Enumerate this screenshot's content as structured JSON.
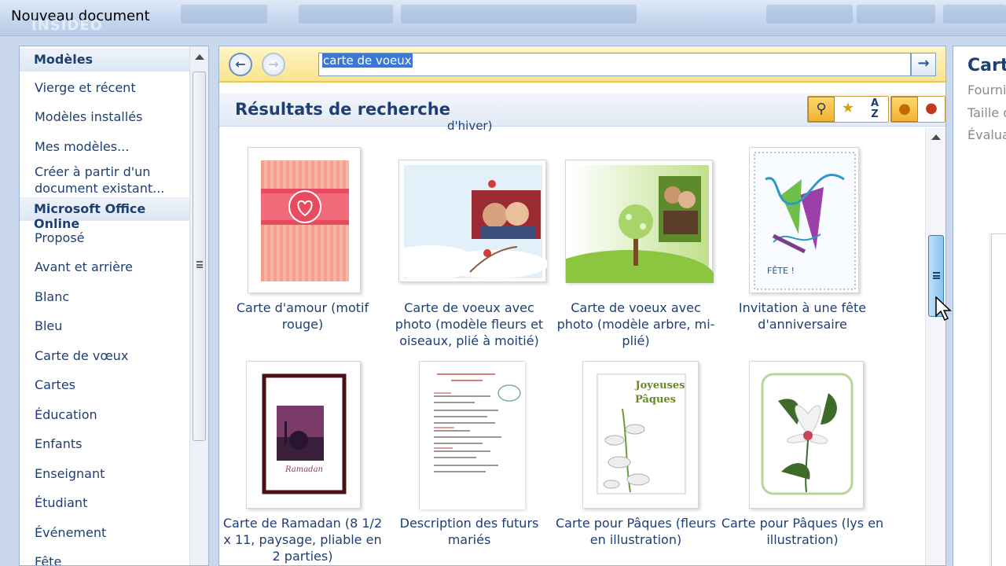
{
  "window": {
    "title": "Nouveau document",
    "watermark": "INSIDEO"
  },
  "sidebar": {
    "sections": [
      {
        "label": "Modèles"
      },
      {
        "label": "Microsoft Office Online"
      }
    ],
    "items_top": [
      {
        "label": "Vierge et récent"
      },
      {
        "label": "Modèles installés"
      },
      {
        "label": "Mes modèles..."
      },
      {
        "label": "Créer à partir d'un document existant..."
      }
    ],
    "items_online": [
      {
        "label": "Proposé"
      },
      {
        "label": "Avant et arrière"
      },
      {
        "label": "Blanc"
      },
      {
        "label": "Bleu"
      },
      {
        "label": "Carte de vœux"
      },
      {
        "label": "Cartes"
      },
      {
        "label": "Éducation"
      },
      {
        "label": "Enfants"
      },
      {
        "label": "Enseignant"
      },
      {
        "label": "Étudiant"
      },
      {
        "label": "Événement"
      },
      {
        "label": "Fête"
      }
    ]
  },
  "search": {
    "back_icon": "back-arrow-icon",
    "forward_icon": "forward-arrow-icon",
    "value": "carte de voeux",
    "go_icon": "go-arrow-icon"
  },
  "results": {
    "title": "Résultats de recherche",
    "partial_text": "d'hiver)",
    "tools": [
      "search-zoom-icon",
      "rating-star-icon",
      "sort-az-icon",
      "user-icon",
      "remove-user-icon"
    ],
    "cards": [
      {
        "label": "Carte d'amour (motif rouge)"
      },
      {
        "label": "Carte de voeux avec photo (modèle fleurs et oiseaux, plié à moitié)"
      },
      {
        "label": "Carte de voeux avec photo (modèle arbre, mi-plié)"
      },
      {
        "label": "Invitation à une fête d'anniversaire"
      },
      {
        "label": "Carte de Ramadan (8 1/2 x 11, paysage, pliable en 2 parties)"
      },
      {
        "label": "Description des futurs mariés"
      },
      {
        "label": "Carte pour Pâques (fleurs en illustration)"
      },
      {
        "label": "Carte pour Pâques (lys en illustration)"
      }
    ],
    "thumb_text": {
      "ramadan": "Ramadan",
      "joyeuses": "Joyeuses",
      "paques": "Pâques",
      "fete": "FÊTE !"
    }
  },
  "details": {
    "title": "Carte",
    "lines": [
      "Fourni",
      "Taille d",
      "Évalua"
    ]
  },
  "colors": {
    "accent_text": "#1e3f73",
    "search_bar": "#f9e38c",
    "selection": "#3b78d6"
  }
}
